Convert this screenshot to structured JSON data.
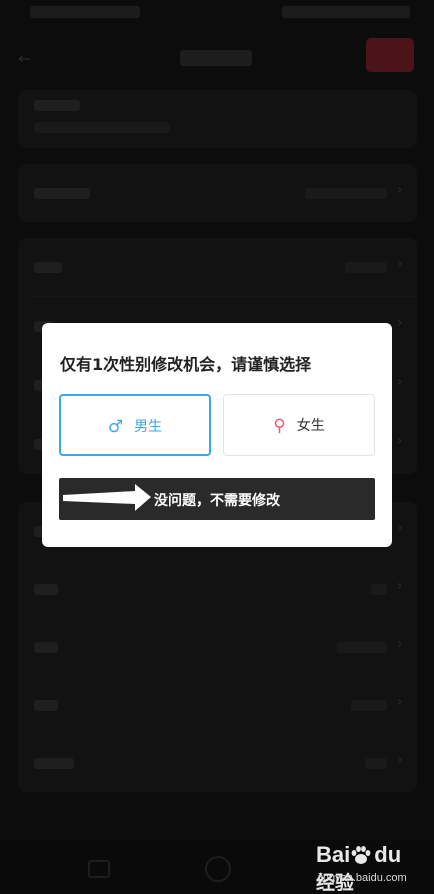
{
  "dialog": {
    "title": "仅有1次性别修改机会，请谨慎选择",
    "options": [
      {
        "label": "男生",
        "icon": "male-symbol-icon",
        "symbol": "♂",
        "selected": true
      },
      {
        "label": "女生",
        "icon": "female-symbol-icon",
        "symbol": "⚲",
        "selected": false
      }
    ],
    "confirm_label": "没问题，不需要修改"
  },
  "watermark": {
    "logo_text": "Bai",
    "logo_suffix": "经验",
    "url": "jingyan.baidu.com"
  },
  "colors": {
    "selected_accent": "#3ba8e6",
    "female_accent": "#e85a73",
    "confirm_bg": "#2a2a2a",
    "overlay_bg": "#0c0c0c"
  }
}
